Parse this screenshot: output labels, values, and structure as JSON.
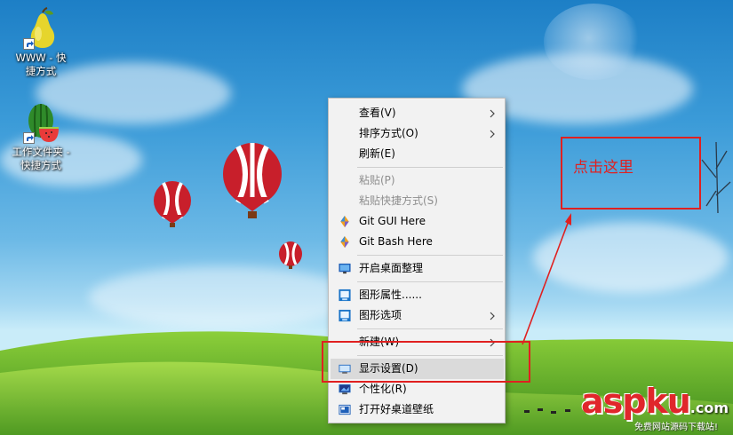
{
  "desktop": {
    "icons": [
      {
        "label_line1": "WWW - 快",
        "label_line2": "捷方式",
        "icon": "pear-icon"
      },
      {
        "label_line1": "工作文件夹 -",
        "label_line2": "快捷方式",
        "icon": "watermelon-icon"
      }
    ]
  },
  "context_menu": {
    "items": [
      {
        "label": "查看(V)",
        "has_submenu": true,
        "enabled": true
      },
      {
        "label": "排序方式(O)",
        "has_submenu": true,
        "enabled": true
      },
      {
        "label": "刷新(E)",
        "has_submenu": false,
        "enabled": true
      },
      {
        "label": "粘贴(P)",
        "has_submenu": false,
        "enabled": false
      },
      {
        "label": "粘贴快捷方式(S)",
        "has_submenu": false,
        "enabled": false
      },
      {
        "label": "Git GUI Here",
        "icon": "git-icon",
        "enabled": true
      },
      {
        "label": "Git Bash Here",
        "icon": "git-icon",
        "enabled": true
      },
      {
        "label": "开启桌面整理",
        "icon": "monitor-icon",
        "enabled": true
      },
      {
        "label": "图形属性......",
        "icon": "graphics-icon",
        "enabled": true
      },
      {
        "label": "图形选项",
        "icon": "graphics-icon",
        "has_submenu": true,
        "enabled": true
      },
      {
        "label": "新建(W)",
        "has_submenu": true,
        "enabled": true
      },
      {
        "label": "显示设置(D)",
        "icon": "display-icon",
        "enabled": true,
        "highlighted": true
      },
      {
        "label": "个性化(R)",
        "icon": "personalize-icon",
        "enabled": true
      },
      {
        "label": "打开好桌道壁纸",
        "icon": "wallpaper-icon",
        "enabled": true
      }
    ]
  },
  "annotation": {
    "callout_text": "点击这里",
    "color": "#e02020"
  },
  "watermark": {
    "logo": "aspku",
    "suffix": ".com",
    "tagline": "免费网站源码下载站!"
  },
  "colors": {
    "menu_bg": "#f2f2f2",
    "menu_hover": "#dadada",
    "disabled_text": "#8e8e8e",
    "sky": "#3b9bd8",
    "grass": "#5fae2a"
  }
}
